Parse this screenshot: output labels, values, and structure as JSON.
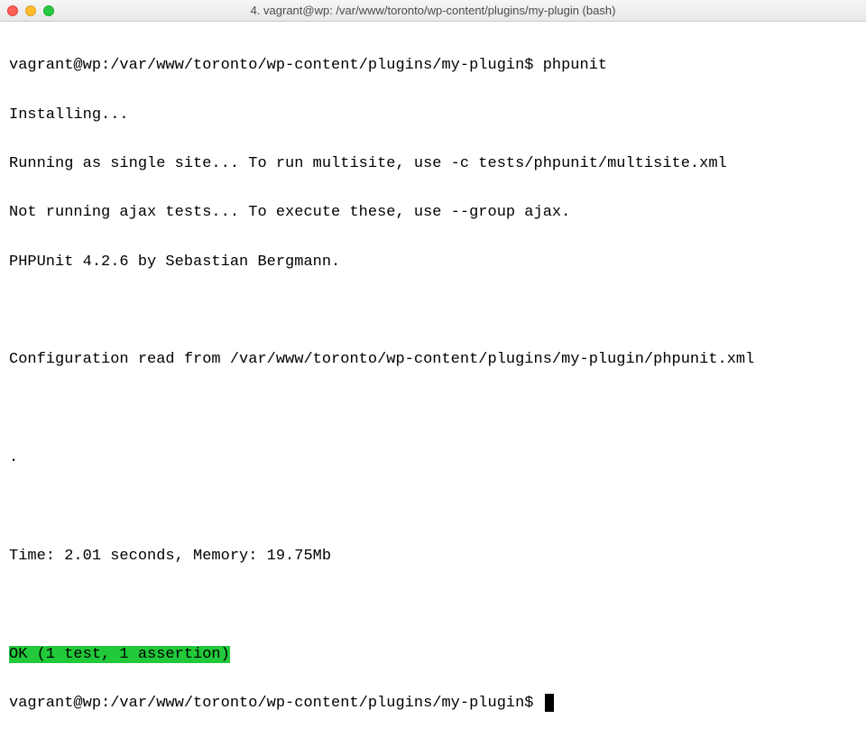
{
  "titlebar": {
    "title": "4. vagrant@wp: /var/www/toronto/wp-content/plugins/my-plugin (bash)"
  },
  "terminal": {
    "prompt1_path": "vagrant@wp:/var/www/toronto/wp-content/plugins/my-plugin$ ",
    "command1": "phpunit",
    "line_installing": "Installing...",
    "line_single_site": "Running as single site... To run multisite, use -c tests/phpunit/multisite.xml",
    "line_ajax": "Not running ajax tests... To execute these, use --group ajax.",
    "line_phpunit_version": "PHPUnit 4.2.6 by Sebastian Bergmann.",
    "line_config": "Configuration read from /var/www/toronto/wp-content/plugins/my-plugin/phpunit.xml",
    "line_dot": ".",
    "line_time": "Time: 2.01 seconds, Memory: 19.75Mb",
    "line_ok": "OK (1 test, 1 assertion)",
    "prompt2_path": "vagrant@wp:/var/www/toronto/wp-content/plugins/my-plugin$ "
  },
  "colors": {
    "ok_bg": "#22c93a",
    "text": "#000000",
    "bg": "#ffffff"
  }
}
